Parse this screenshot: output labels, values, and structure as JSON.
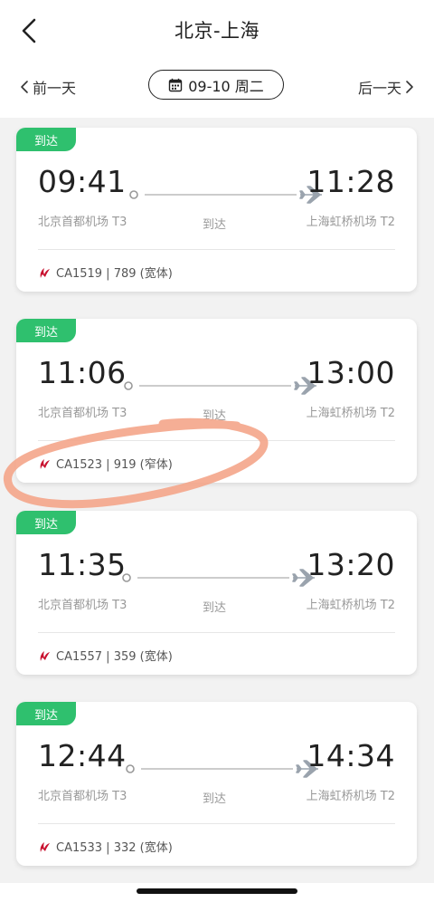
{
  "header": {
    "title": "北京-上海",
    "prev_day": "前一天",
    "next_day": "后一天",
    "date_label": "09-10 周二"
  },
  "colors": {
    "status_badge": "#2fc06e",
    "highlight": "#f4a58a",
    "airline_logo": "#c8102e"
  },
  "flights": [
    {
      "status": "到达",
      "dep_time": "09:41",
      "arr_time": "11:28",
      "dep_airport": "北京首都机场 T3",
      "arr_airport": "上海虹桥机场 T2",
      "status_text": "到达",
      "flight_info": "CA1519 | 789 (宽体)"
    },
    {
      "status": "到达",
      "dep_time": "11:06",
      "arr_time": "13:00",
      "dep_airport": "北京首都机场 T3",
      "arr_airport": "上海虹桥机场 T2",
      "status_text": "到达",
      "flight_info": "CA1523 | 919 (窄体)"
    },
    {
      "status": "到达",
      "dep_time": "11:35",
      "arr_time": "13:20",
      "dep_airport": "北京首都机场 T3",
      "arr_airport": "上海虹桥机场 T2",
      "status_text": "到达",
      "flight_info": "CA1557 | 359 (宽体)"
    },
    {
      "status": "到达",
      "dep_time": "12:44",
      "arr_time": "14:34",
      "dep_airport": "北京首都机场 T3",
      "arr_airport": "上海虹桥机场 T2",
      "status_text": "到达",
      "flight_info": "CA1533 | 332 (宽体)"
    }
  ]
}
